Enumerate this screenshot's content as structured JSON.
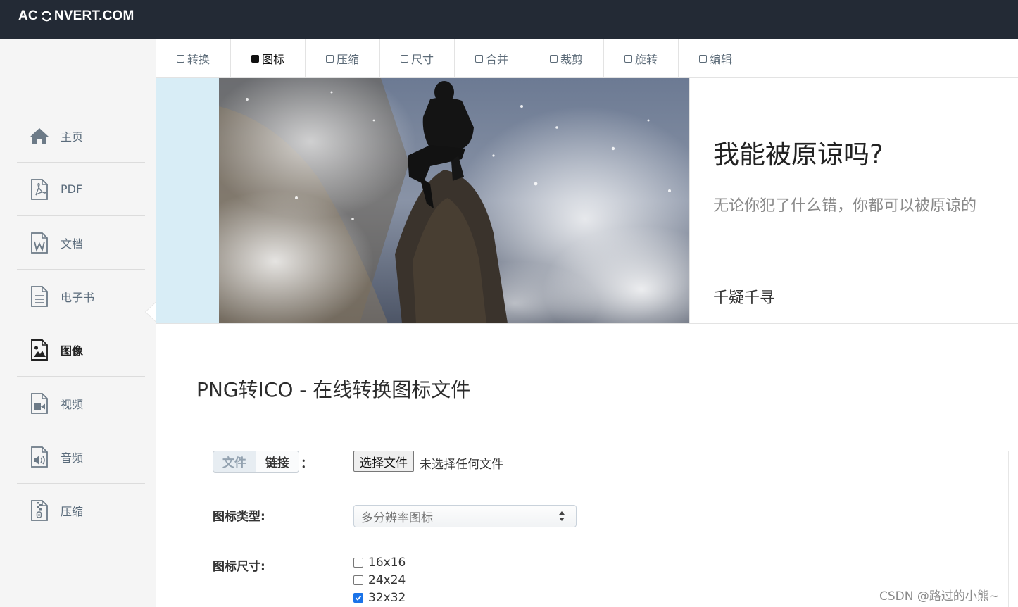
{
  "header": {
    "logo_left": "AC",
    "logo_right": "NVERT.COM"
  },
  "sidebar": {
    "items": [
      {
        "label": "主页",
        "icon": "home-icon"
      },
      {
        "label": "PDF",
        "icon": "pdf-icon"
      },
      {
        "label": "文档",
        "icon": "word-document-icon"
      },
      {
        "label": "电子书",
        "icon": "ebook-icon"
      },
      {
        "label": "图像",
        "icon": "image-icon",
        "active": true
      },
      {
        "label": "视频",
        "icon": "video-icon"
      },
      {
        "label": "音频",
        "icon": "audio-icon"
      },
      {
        "label": "压缩",
        "icon": "archive-icon"
      }
    ]
  },
  "tabs": [
    {
      "label": "转换"
    },
    {
      "label": "图标",
      "active": true
    },
    {
      "label": "压缩"
    },
    {
      "label": "尺寸"
    },
    {
      "label": "合并"
    },
    {
      "label": "裁剪"
    },
    {
      "label": "旋转"
    },
    {
      "label": "编辑"
    }
  ],
  "banner": {
    "title": "我能被原谅吗?",
    "subtitle": "无论你犯了什么错，你都可以被原谅的",
    "footer": "千疑千寻"
  },
  "main": {
    "title": "PNG转ICO - 在线转换图标文件",
    "source_toggle": {
      "file": "文件",
      "link": "链接",
      "colon": "："
    },
    "file_button": "选择文件",
    "file_status": "未选择任何文件",
    "icon_type_label": "图标类型:",
    "icon_type_value": "多分辨率图标",
    "icon_size_label": "图标尺寸:",
    "sizes": [
      {
        "label": "16x16",
        "checked": false
      },
      {
        "label": "24x24",
        "checked": false
      },
      {
        "label": "32x32",
        "checked": true
      }
    ]
  },
  "watermark": "CSDN @路过的小熊~",
  "colors": {
    "header_bg": "#232a35",
    "sidebar_bg": "#f5f5f5",
    "banner_accent": "#d8edf6",
    "checkbox_checked": "#1a73e8"
  }
}
